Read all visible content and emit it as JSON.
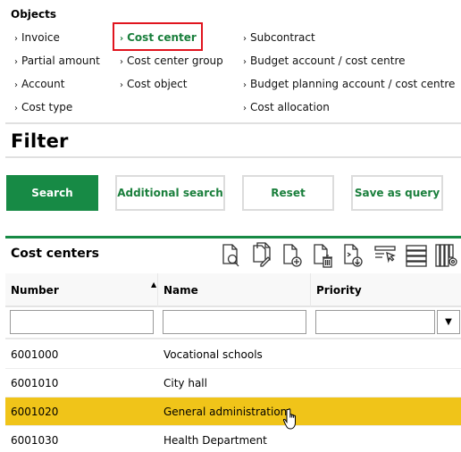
{
  "objects": {
    "title": "Objects",
    "chevron": "›",
    "col1": [
      "Invoice",
      "Partial amount",
      "Account",
      "Cost type"
    ],
    "col2": [
      "Cost center",
      "Cost center group",
      "Cost object"
    ],
    "col3": [
      "Subcontract",
      "Budget account / cost centre",
      "Budget planning account / cost centre",
      "Cost allocation"
    ],
    "active": "Cost center"
  },
  "filter": {
    "title": "Filter",
    "buttons": {
      "search": "Search",
      "additional_search": "Additional search",
      "reset": "Reset",
      "save_as_query": "Save as query"
    }
  },
  "grid": {
    "title": "Cost centers",
    "toolbar_icons": [
      "view-document-icon",
      "edit-document-icon",
      "add-document-icon",
      "delete-document-icon",
      "export-document-icon",
      "select-row-icon",
      "list-rows-icon",
      "column-settings-icon"
    ],
    "columns": [
      "Number",
      "Name",
      "Priority"
    ],
    "sort": {
      "column": "Number",
      "direction": "ascending",
      "glyph": "▲"
    },
    "filters": {
      "number": "",
      "name": "",
      "priority": ""
    },
    "dropdown_glyph": "▼",
    "rows": [
      {
        "number": "6001000",
        "name": "Vocational schools",
        "priority": "",
        "selected": false
      },
      {
        "number": "6001010",
        "name": "City hall",
        "priority": "",
        "selected": false
      },
      {
        "number": "6001020",
        "name": "General administration",
        "priority": "",
        "selected": true
      },
      {
        "number": "6001030",
        "name": "Health Department",
        "priority": "",
        "selected": false
      }
    ]
  },
  "colors": {
    "accent": "#178a45",
    "selection": "#f0c419",
    "active_outline": "#e0141e"
  }
}
